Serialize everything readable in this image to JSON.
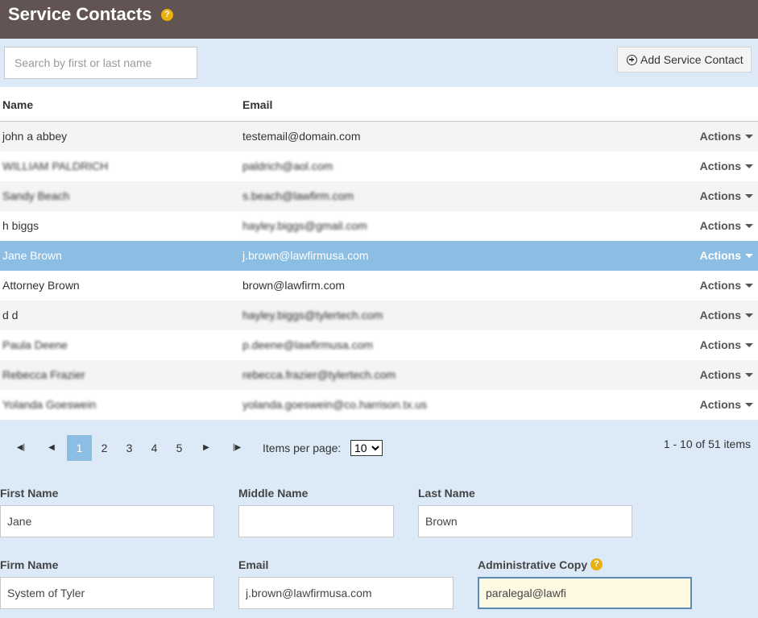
{
  "header": {
    "title": "Service Contacts",
    "help": "?"
  },
  "search": {
    "placeholder": "Search by first or last name"
  },
  "toolbar": {
    "add_label": "Add Service Contact"
  },
  "table": {
    "columns": {
      "name": "Name",
      "email": "Email"
    },
    "actions_label": "Actions",
    "rows": [
      {
        "name": "john a abbey",
        "email": "testemail@domain.com"
      },
      {
        "name": "WILLIAM PALDRICH",
        "email": "paldrich@aol.com"
      },
      {
        "name": "Sandy Beach",
        "email": "s.beach@lawfirm.com"
      },
      {
        "name": "h biggs",
        "email": "hayley.biggs@gmail.com"
      },
      {
        "name": "Jane Brown",
        "email": "j.brown@lawfirmusa.com"
      },
      {
        "name": "Attorney Brown",
        "email": "brown@lawfirm.com"
      },
      {
        "name": "d d",
        "email": "hayley.biggs@tylertech.com"
      },
      {
        "name": "Paula Deene",
        "email": "p.deene@lawfirmusa.com"
      },
      {
        "name": "Rebecca Frazier",
        "email": "rebecca.frazier@tylertech.com"
      },
      {
        "name": "Yolanda Goeswein",
        "email": "yolanda.goeswein@co.harrison.tx.us"
      }
    ]
  },
  "pager": {
    "pages": [
      "1",
      "2",
      "3",
      "4",
      "5"
    ],
    "current": "1",
    "icons": {
      "first": "first-page-icon",
      "prev": "prev-page-icon",
      "next": "next-page-icon",
      "last": "last-page-icon"
    },
    "items_per_page_label": "Items per page:",
    "items_per_page_value": "10",
    "count_text": "1 - 10 of 51 items"
  },
  "form": {
    "first_name": {
      "label": "First Name",
      "value": "Jane"
    },
    "middle_name": {
      "label": "Middle Name",
      "value": ""
    },
    "last_name": {
      "label": "Last Name",
      "value": "Brown"
    },
    "firm_name": {
      "label": "Firm Name",
      "value": "System of Tyler"
    },
    "email": {
      "label": "Email",
      "value": "j.brown@lawfirmusa.com"
    },
    "admin_copy": {
      "label": "Administrative Copy",
      "value": "paralegal@lawfi",
      "help": "?"
    }
  },
  "colors": {
    "header": "#625453",
    "selected_row": "#8cbee3",
    "panel": "#dbeaf6",
    "help": "#e8b10e"
  }
}
